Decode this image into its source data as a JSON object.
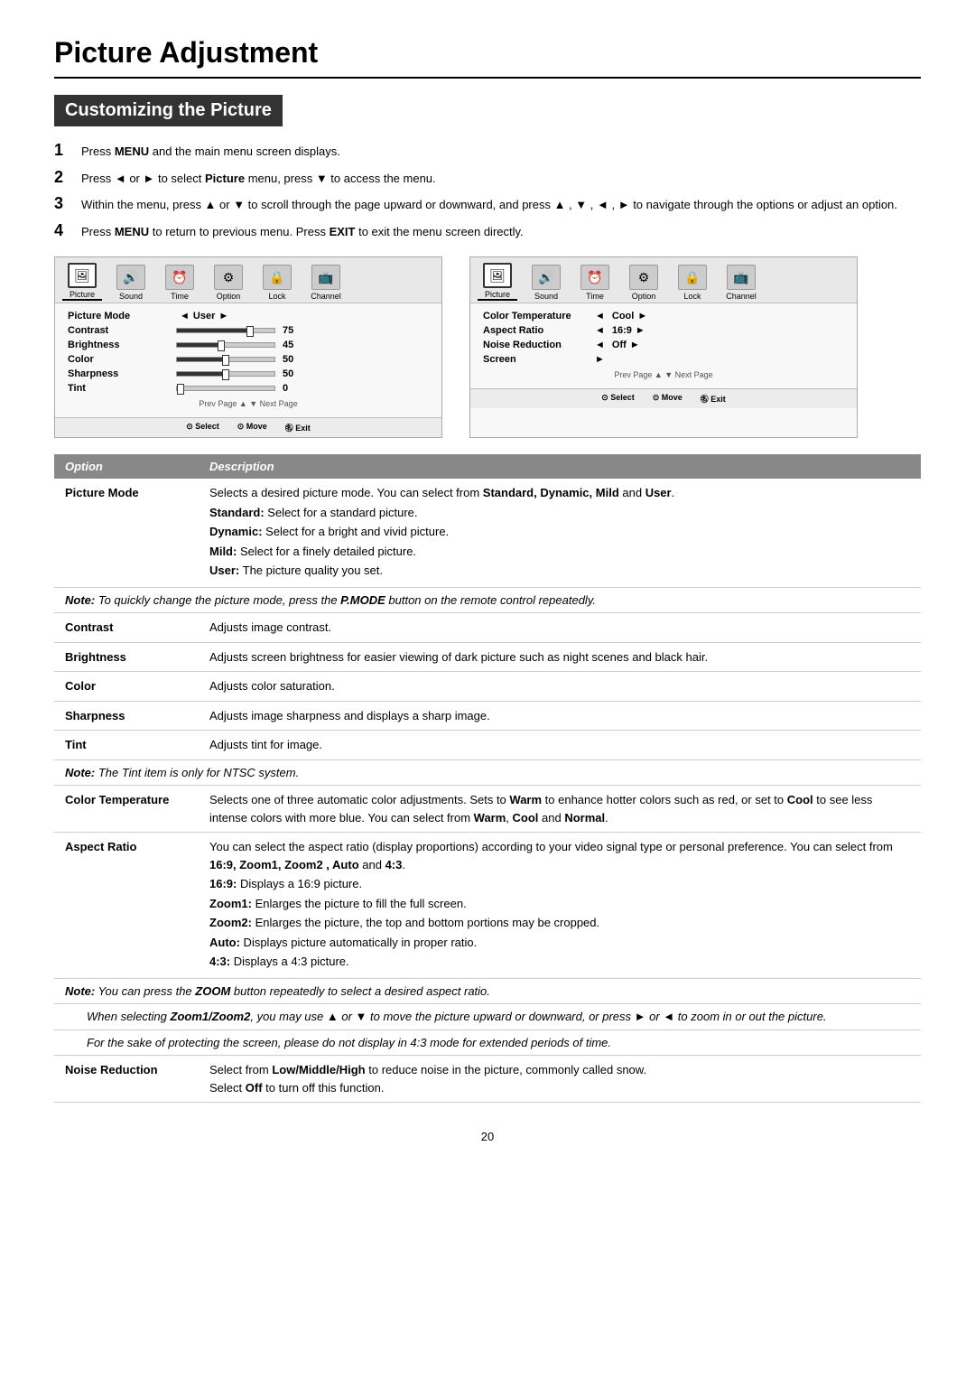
{
  "page": {
    "title": "Picture Adjustment",
    "section": "Customizing the Picture",
    "page_number": "20"
  },
  "steps": [
    {
      "num": "1",
      "text": "Press <b>MENU</b> and the main menu screen displays."
    },
    {
      "num": "2",
      "text": "Press ◄ or ► to select <b>Picture</b> menu,  press ▼  to access the menu."
    },
    {
      "num": "3",
      "text": "Within the menu, press ▲ or ▼ to scroll through the page upward or downward, and press ▲ , ▼ , ◄ , ► to navigate through the options or adjust an option."
    },
    {
      "num": "4",
      "text": "Press <b>MENU</b> to return to previous menu. Press <b>EXIT</b> to exit the menu screen directly."
    }
  ],
  "menu_left": {
    "icons": [
      {
        "label": "Picture",
        "active": true,
        "icon": "🖼"
      },
      {
        "label": "Sound",
        "active": false,
        "icon": "🔊"
      },
      {
        "label": "Time",
        "active": false,
        "icon": "⏰"
      },
      {
        "label": "Option",
        "active": false,
        "icon": "⚙"
      },
      {
        "label": "Lock",
        "active": false,
        "icon": "🔒"
      },
      {
        "label": "Channel",
        "active": false,
        "icon": "📺"
      }
    ],
    "items": [
      {
        "label": "Picture Mode",
        "type": "arrow",
        "value": "User"
      },
      {
        "label": "Contrast",
        "type": "slider",
        "value": "75",
        "pct": 75
      },
      {
        "label": "Brightness",
        "type": "slider",
        "value": "45",
        "pct": 45
      },
      {
        "label": "Color",
        "type": "slider",
        "value": "50",
        "pct": 50
      },
      {
        "label": "Sharpness",
        "type": "slider",
        "value": "50",
        "pct": 50
      },
      {
        "label": "Tint",
        "type": "slider",
        "value": "0",
        "pct": 0
      }
    ],
    "page_nav": "Prev Page ▲ ▼ Next Page",
    "bottom": [
      {
        "icon": "⊙",
        "label": "Select"
      },
      {
        "icon": "⊙",
        "label": "Move"
      },
      {
        "icon": "M",
        "label": "Exit"
      }
    ]
  },
  "menu_right": {
    "icons": [
      {
        "label": "Picture",
        "active": true,
        "icon": "🖼"
      },
      {
        "label": "Sound",
        "active": false,
        "icon": "🔊"
      },
      {
        "label": "Time",
        "active": false,
        "icon": "⏰"
      },
      {
        "label": "Option",
        "active": false,
        "icon": "⚙"
      },
      {
        "label": "Lock",
        "active": false,
        "icon": "🔒"
      },
      {
        "label": "Channel",
        "active": false,
        "icon": "📺"
      }
    ],
    "items": [
      {
        "label": "Color Temperature",
        "type": "arrow",
        "value": "Cool"
      },
      {
        "label": "Aspect Ratio",
        "type": "arrow",
        "value": "16:9"
      },
      {
        "label": "Noise Reduction",
        "type": "arrow",
        "value": "Off"
      },
      {
        "label": "Screen",
        "type": "arrow-only",
        "value": ""
      }
    ],
    "page_nav": "Prev Page ▲ ▼ Next Page",
    "bottom": [
      {
        "icon": "⊙",
        "label": "Select"
      },
      {
        "icon": "⊙",
        "label": "Move"
      },
      {
        "icon": "M",
        "label": "Exit"
      }
    ]
  },
  "table": {
    "col_option": "Option",
    "col_description": "Description",
    "rows": [
      {
        "option": "Picture Mode",
        "desc": "Selects a desired picture mode. You can select from <b>Standard, Dynamic, Mild</b> and <b>User</b>.",
        "sub": [
          "<b>Standard:</b> Select for a standard picture.",
          "<b>Dynamic:</b> Select for a bright and vivid picture.",
          "<b>Mild:</b> Select for a finely detailed picture.",
          "<b>User:</b> The picture quality you set."
        ],
        "note": "<i><b>Note:</b> To quickly change the picture mode, press the <b>P.MODE</b> button on the remote control repeatedly.</i>",
        "type": "complex"
      },
      {
        "option": "Contrast",
        "desc": "Adjusts image contrast.",
        "type": "simple"
      },
      {
        "option": "Brightness",
        "desc": "Adjusts screen brightness for easier viewing of dark picture such as night scenes and black hair.",
        "type": "simple"
      },
      {
        "option": "Color",
        "desc": "Adjusts color saturation.",
        "type": "simple"
      },
      {
        "option": "Sharpness",
        "desc": "Adjusts image sharpness and displays a sharp image.",
        "type": "simple"
      },
      {
        "option": "Tint",
        "desc": "Adjusts tint for image.",
        "note": "<i><b>Note:</b> The Tint item is only for NTSC system.</i>",
        "type": "simple-note"
      },
      {
        "option": "Color Temperature",
        "desc": "Selects one of three automatic color adjustments.  Sets to <b>Warm</b> to enhance hotter colors such as red,  or set to <b>Cool</b> to see less intense colors with more blue.  You can select from <b>Warm</b>, <b>Cool</b> and <b>Normal</b>.",
        "type": "simple"
      },
      {
        "option": "Aspect Ratio",
        "desc": "You can select the aspect ratio (display proportions) according to your video signal type or personal preference. You can select from <b>16:9,  Zoom1, Zoom2 , Auto</b> and <b>4:3</b>.",
        "sub": [
          "<b>16:9:</b> Displays a 16:9 picture.",
          "<b>Zoom1:</b> Enlarges the picture to fill the full screen.",
          "<b>Zoom2:</b> Enlarges the picture, the top and bottom portions may be cropped.",
          "<b>Auto:</b> Displays picture automatically in proper ratio.",
          "<b>4:3:</b> Displays a 4:3 picture."
        ],
        "note": "<i><b>Note:</b> You can press the <b>ZOOM</b> button repeatedly to select a desired aspect ratio.</i>",
        "note2": "<i>When selecting <b>Zoom1/Zoom2</b>, you may use ▲ or ▼ to move the picture upward or downward, or press ► or ◄ to zoom in or out the picture.</i>",
        "note3": "<i>For the sake of protecting the screen, please do not display in 4:3 mode for extended periods of time.</i>",
        "type": "complex"
      },
      {
        "option": "Noise Reduction",
        "desc": "Select from <b>Low/Middle/High</b> to reduce noise in the picture, commonly called snow. Select <b>Off</b> to turn off this function.",
        "type": "simple"
      }
    ]
  }
}
